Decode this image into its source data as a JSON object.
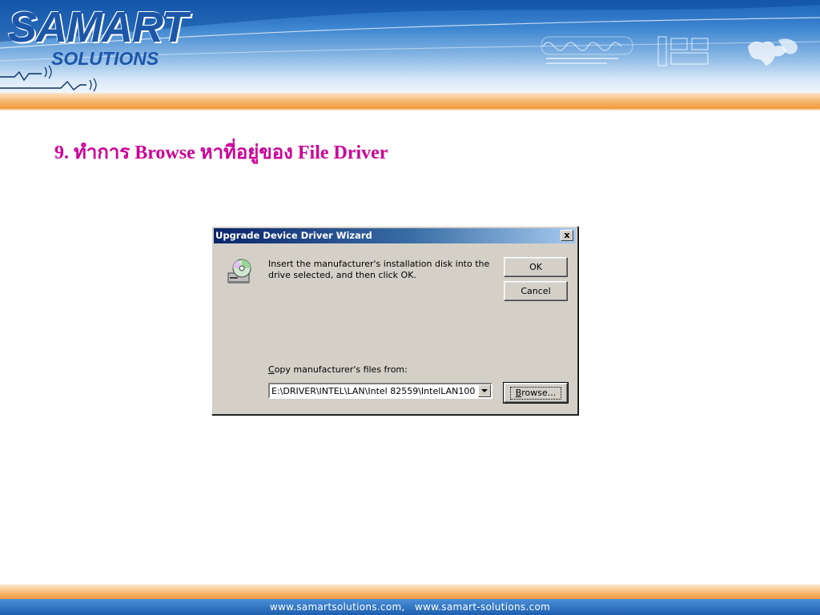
{
  "header": {
    "logo_main": "SAMART",
    "logo_sub": "SOLUTIONS"
  },
  "slide": {
    "title": "9. ทำการ Browse หาที่อยู่ของ File Driver"
  },
  "dialog": {
    "title": "Upgrade Device Driver Wizard",
    "close_label": "x",
    "message": "Insert the manufacturer's installation disk into the drive selected, and then click OK.",
    "ok_label": "OK",
    "cancel_label": "Cancel",
    "copy_label_accel": "C",
    "copy_label_rest": "opy manufacturer's files from:",
    "path_value": "E:\\DRIVER\\INTEL\\LAN\\Intel 82559\\IntelLAN100",
    "browse_accel": "B",
    "browse_rest": "rowse..."
  },
  "footer": {
    "text": "www.samartsolutions.com,   www.samart-solutions.com"
  },
  "colors": {
    "title_magenta": "#cc0099",
    "brand_blue": "#1c56a8",
    "dialog_gray": "#d4d0c8",
    "titlebar_navy": "#0a246a",
    "stripe_orange": "#f09a3c"
  }
}
